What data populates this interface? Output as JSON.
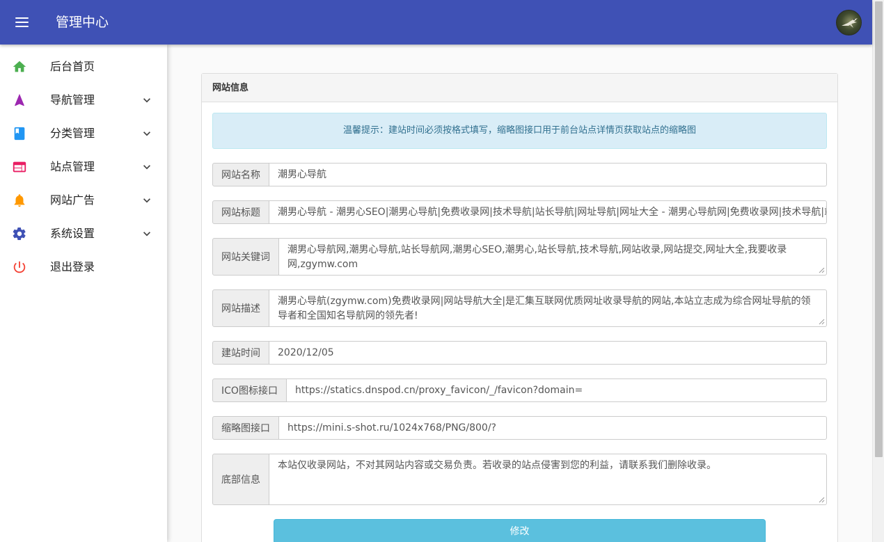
{
  "header": {
    "title": "管理中心",
    "colors": {
      "bar": "#3f51b5",
      "accent": "#5bc0de"
    }
  },
  "sidebar": {
    "items": [
      {
        "label": "后台首页",
        "icon": "home-icon",
        "color": "#4caf50",
        "has_submenu": false
      },
      {
        "label": "导航管理",
        "icon": "navigation-arrow-icon",
        "color": "#9c27b0",
        "has_submenu": true
      },
      {
        "label": "分类管理",
        "icon": "book-icon",
        "color": "#2196f3",
        "has_submenu": true
      },
      {
        "label": "站点管理",
        "icon": "browser-window-icon",
        "color": "#e91e63",
        "has_submenu": true
      },
      {
        "label": "网站广告",
        "icon": "bell-icon",
        "color": "#ff9800",
        "has_submenu": true
      },
      {
        "label": "系统设置",
        "icon": "gear-icon",
        "color": "#3f51b5",
        "has_submenu": true
      },
      {
        "label": "退出登录",
        "icon": "power-icon",
        "color": "#f44336",
        "has_submenu": false
      }
    ]
  },
  "panel": {
    "title": "网站信息",
    "alert": "温馨提示：建站时间必须按格式填写，缩略图接口用于前台站点详情页获取站点的缩略图",
    "fields": {
      "name": {
        "label": "网站名称",
        "value": "潮男心导航"
      },
      "title": {
        "label": "网站标题",
        "value": "潮男心导航 - 潮男心SEO|潮男心导航|免费收录网|技术导航|站长导航|网址导航|网址大全 - 潮男心导航网|免费收录网|技术导航|站长导航|网址导航|网址大全"
      },
      "keywords": {
        "label": "网站关键词",
        "value": "潮男心导航网,潮男心导航,站长导航网,潮男心SEO,潮男心,站长导航,技术导航,网站收录,网站提交,网址大全,我要收录网,zgymw.com"
      },
      "description": {
        "label": "网站描述",
        "value": "潮男心导航(zgymw.com)免费收录网|网站导航大全|是汇集互联网优质网址收录导航的网站,本站立志成为综合网址导航的领导者和全国知名导航网的领先者!"
      },
      "founded": {
        "label": "建站时间",
        "value": "2020/12/05"
      },
      "ico_api": {
        "label": "ICO图标接口",
        "value": "https://statics.dnspod.cn/proxy_favicon/_/favicon?domain="
      },
      "thumb_api": {
        "label": "缩略图接口",
        "value": "https://mini.s-shot.ru/1024x768/PNG/800/?"
      },
      "footer": {
        "label": "底部信息",
        "value": "本站仅收录网站，不对其网站内容或交易负责。若收录的站点侵害到您的利益，请联系我们删除收录。"
      }
    },
    "submit_label": "修改"
  }
}
